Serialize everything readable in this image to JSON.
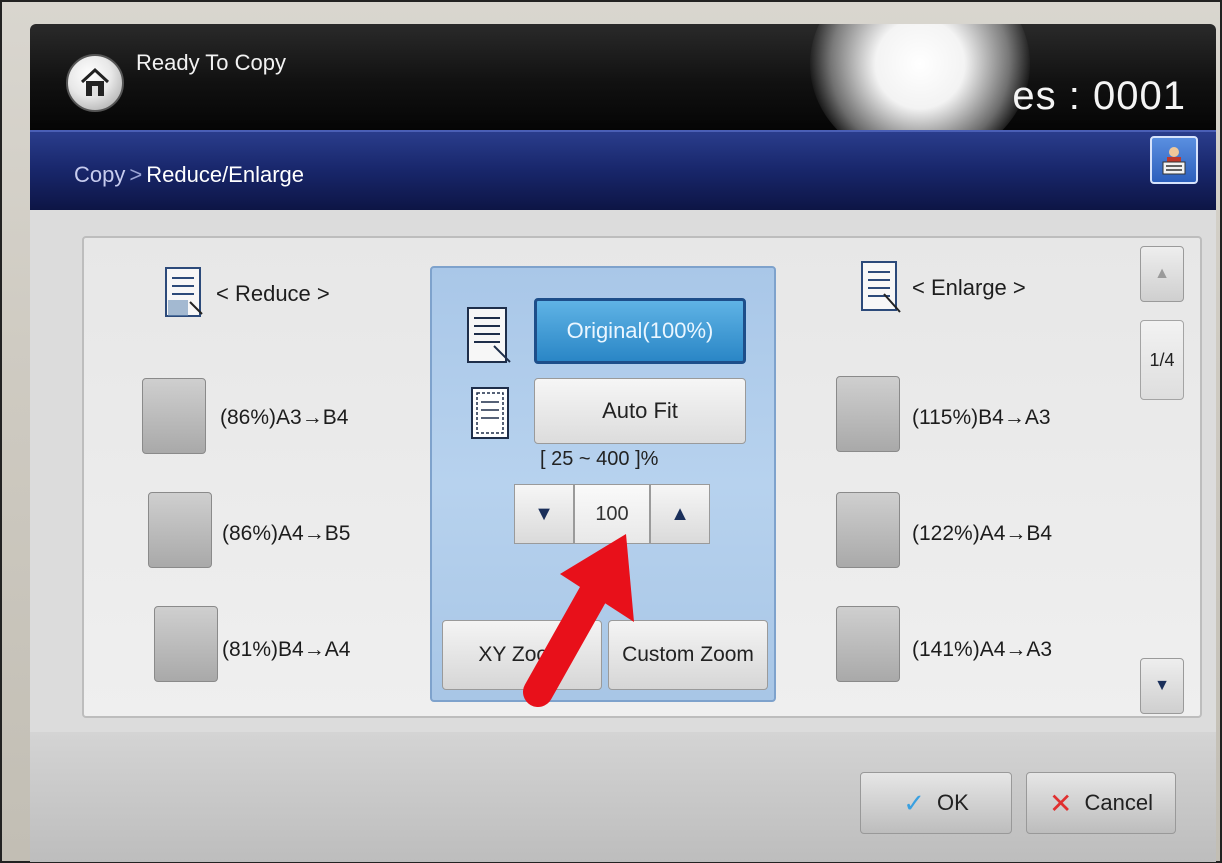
{
  "status_bar": {
    "title": "Ready To Copy",
    "counter_text": "es : 0001"
  },
  "breadcrumb": {
    "parent": "Copy",
    "separator": ">",
    "current": "Reduce/Enlarge"
  },
  "reduce": {
    "header": "< Reduce >",
    "presets": [
      {
        "label": "(86%)A3→B4"
      },
      {
        "label": "(86%)A4→B5"
      },
      {
        "label": "(81%)B4→A4"
      }
    ]
  },
  "enlarge": {
    "header": "< Enlarge >",
    "presets": [
      {
        "label": "(115%)B4→A3"
      },
      {
        "label": "(122%)A4→B4"
      },
      {
        "label": "(141%)A4→A3"
      }
    ]
  },
  "center": {
    "original_label": "Original(100%)",
    "autofit_label": "Auto Fit",
    "range_text": "[ 25 ~ 400 ]%",
    "zoom_value": "100",
    "decrease_symbol": "▼",
    "increase_symbol": "▲",
    "xy_zoom_label": "XY Zoom",
    "custom_zoom_label": "Custom Zoom"
  },
  "pager": {
    "page_indicator": "1/4",
    "up_symbol": "▲",
    "down_symbol": "▼"
  },
  "actions": {
    "ok_label": "OK",
    "ok_symbol": "✓",
    "cancel_label": "Cancel",
    "cancel_symbol": "✕"
  },
  "icons": {
    "home": "home-icon",
    "job_status": "job-status-icon",
    "document": "document-icon",
    "arrow": "red-pointer-arrow"
  },
  "colors": {
    "status_bar": "#111111",
    "breadcrumb_bar": "#18266a",
    "center_panel": "#b7d2ee",
    "original_selected": "#2a86c6",
    "annotation_arrow": "#e8101a"
  }
}
